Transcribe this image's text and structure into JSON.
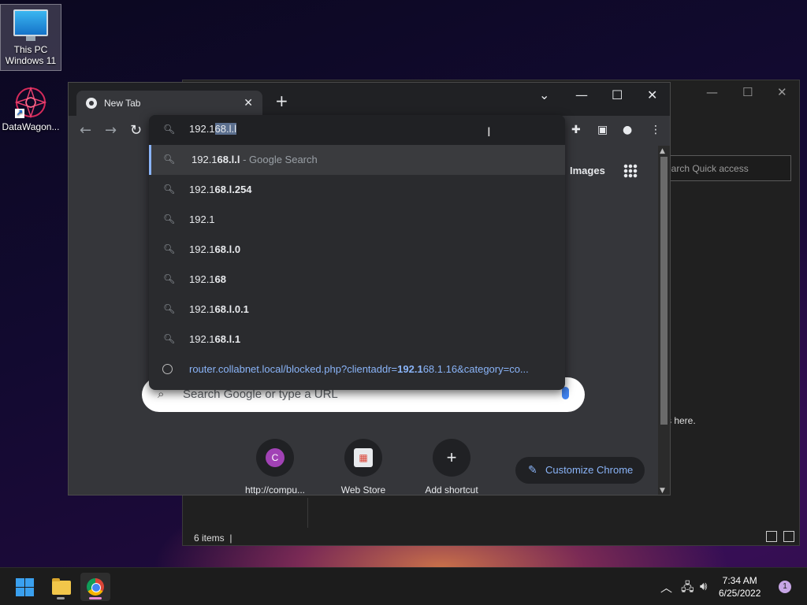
{
  "desktop": {
    "icons": [
      {
        "label_line1": "This PC",
        "label_line2": "Windows 11"
      },
      {
        "label": "DataWagon..."
      }
    ]
  },
  "explorer": {
    "search_placeholder": "earch Quick access",
    "hint_text": "s here.",
    "status": "6 items"
  },
  "chrome": {
    "tab_title": "New Tab",
    "images_link": "Images",
    "ntp_search_placeholder": "Search Google or type a URL",
    "shortcuts": [
      {
        "label": "http://compu...",
        "badge": "C",
        "badge_color": "#a142b5"
      },
      {
        "label": "Web Store"
      },
      {
        "label": "Add shortcut",
        "badge": "+"
      }
    ],
    "customize_label": "Customize Chrome"
  },
  "omnibox": {
    "typed_prefix": "192.1",
    "typed_selected": "68.l.l",
    "suggestions": [
      {
        "plain": "192.1",
        "bold": "68.l.l",
        "suffix": " - Google Search",
        "active": true
      },
      {
        "plain": "192.1",
        "bold": "68.l.254"
      },
      {
        "plain": "192.1",
        "bold": ""
      },
      {
        "plain": "192.1",
        "bold": "68.l.0"
      },
      {
        "plain": "192.1",
        "bold": "68"
      },
      {
        "plain": "192.1",
        "bold": "68.l.0.1"
      },
      {
        "plain": "192.1",
        "bold": "68.l.1"
      }
    ],
    "url_suggestion": {
      "pre": "router.collabnet.local/blocked.php?clientaddr=",
      "bold": "192.1",
      "post": "68.1.16&category=co..."
    }
  },
  "taskbar": {
    "time": "7:34 AM",
    "date": "6/25/2022",
    "notification_count": "1"
  }
}
